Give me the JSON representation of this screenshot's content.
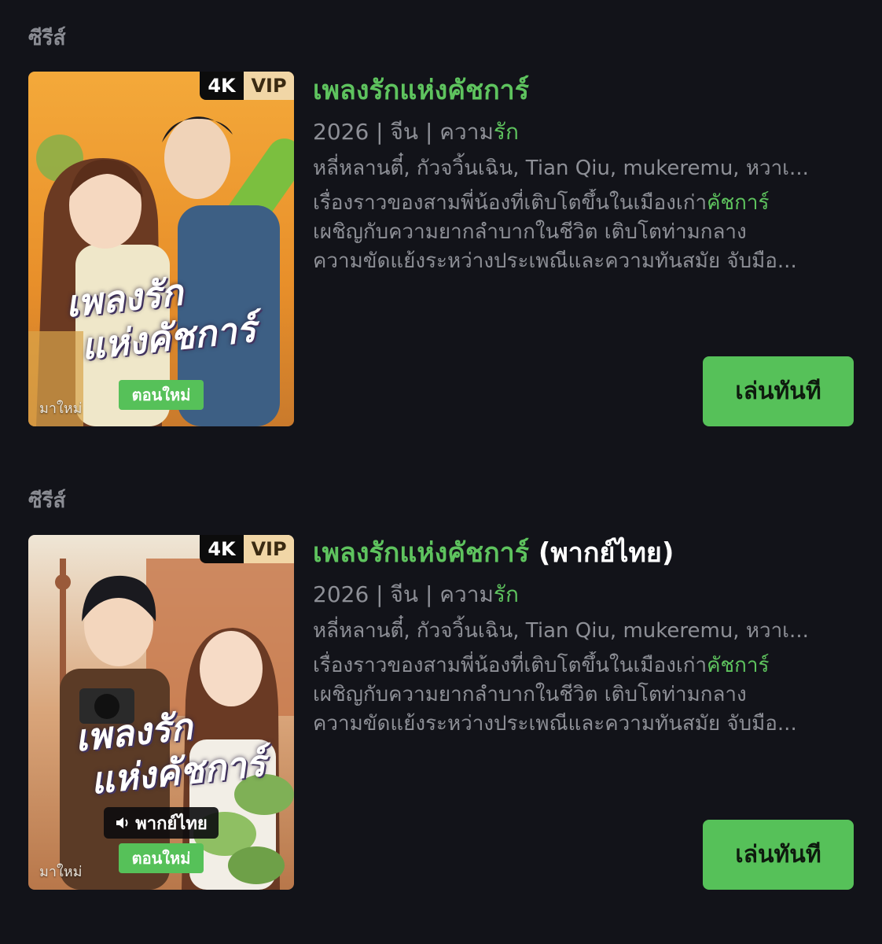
{
  "items": [
    {
      "section_label": "ซีรีส์",
      "badge_quality": "4K",
      "badge_tier": "VIP",
      "poster_title_line1": "เพลงรัก",
      "poster_title_line2": "แห่งคัชการ์",
      "new_episode_label": "ตอนใหม่",
      "new_arrival_label": "มาใหม่",
      "title": "เพลงรักแห่งคัชการ์",
      "title_suffix": "",
      "year": "2026",
      "country": "จีน",
      "genre_prefix": "ความ",
      "genre_highlight": "รัก",
      "separator": " | ",
      "cast": "หลี่หลานตี๋, กัวจวิ้นเฉิน, Tian Qiu, mukeremu, หวาเ...",
      "desc_line1_text": "เรื่องราวของสามพี่น้องที่เติบโตขึ้นในเมืองเก่า",
      "desc_line1_highlight": "คัชการ์",
      "desc_line2": "เผชิญกับความยากลำบากในชีวิต เติบโตท่ามกลาง",
      "desc_line3": "ความขัดแย้งระหว่างประเพณีและความทันสมัย จับมือ...",
      "play_label": "เล่นทันที"
    },
    {
      "section_label": "ซีรีส์",
      "badge_quality": "4K",
      "badge_tier": "VIP",
      "poster_title_line1": "เพลงรัก",
      "poster_title_line2": "แห่งคัชการ์",
      "dub_label": "พากย์ไทย",
      "new_episode_label": "ตอนใหม่",
      "new_arrival_label": "มาใหม่",
      "title": "เพลงรักแห่งคัชการ์",
      "title_suffix": "(พากย์ไทย)",
      "year": "2026",
      "country": "จีน",
      "genre_prefix": "ความ",
      "genre_highlight": "รัก",
      "separator": " | ",
      "cast": "หลี่หลานตี๋, กัวจวิ้นเฉิน, Tian Qiu, mukeremu, หวาเ...",
      "desc_line1_text": "เรื่องราวของสามพี่น้องที่เติบโตขึ้นในเมืองเก่า",
      "desc_line1_highlight": "คัชการ์",
      "desc_line2": "เผชิญกับความยากลำบากในชีวิต เติบโตท่ามกลาง",
      "desc_line3": "ความขัดแย้งระหว่างประเพณีและความทันสมัย จับมือ...",
      "play_label": "เล่นทันที"
    }
  ],
  "icons": {
    "speaker": "speaker-icon"
  },
  "colors": {
    "background": "#121319",
    "accent_green": "#5ec35e",
    "button_green": "#56c159",
    "muted_text": "#8d8f96",
    "vip_gold": "#f1d6a6"
  }
}
